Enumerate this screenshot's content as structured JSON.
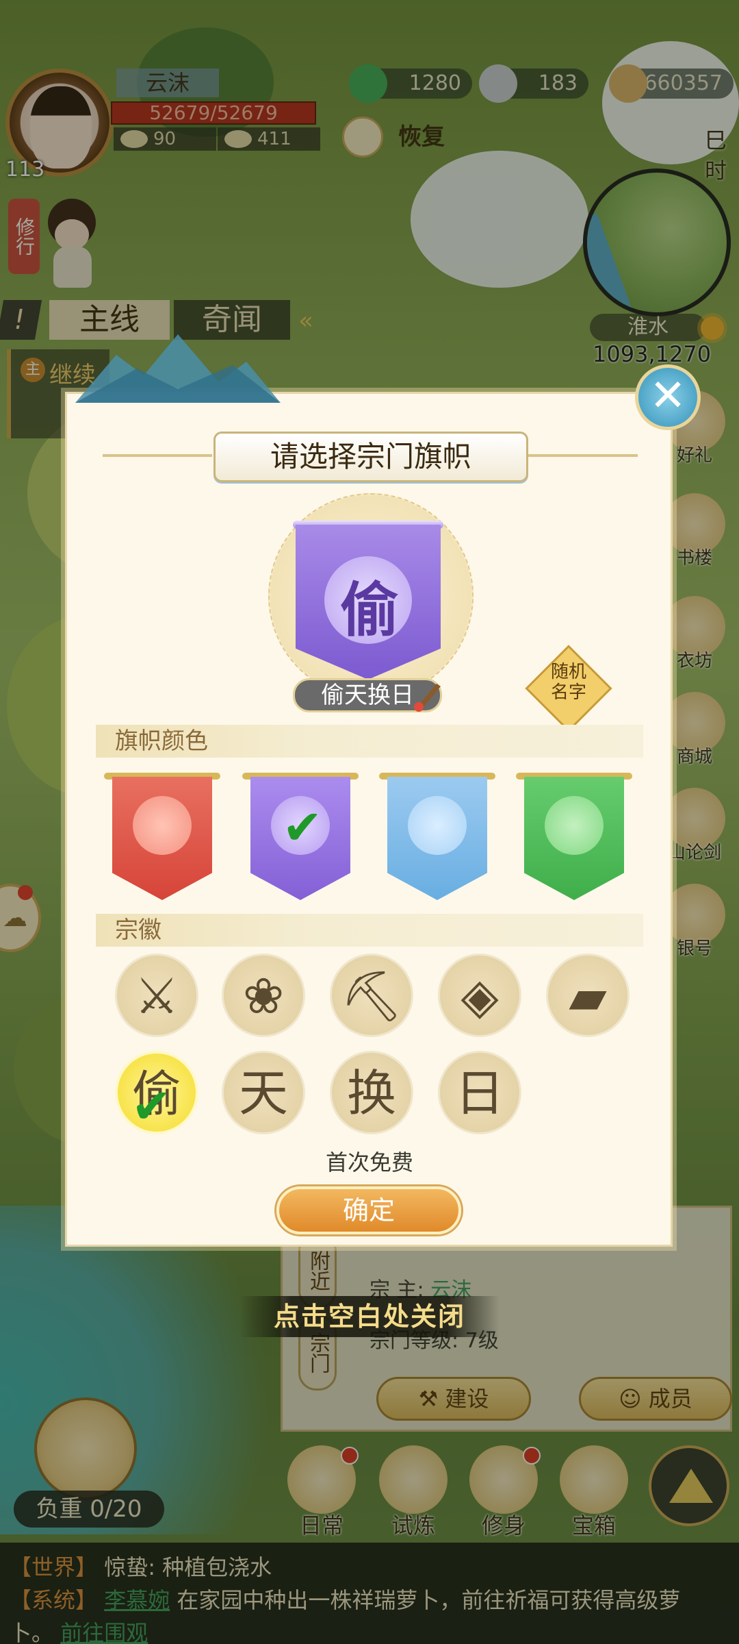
{
  "hud": {
    "player_name": "云沫",
    "level": "113",
    "hp": "52679/52679",
    "stat1": "90",
    "stat2": "411",
    "resources": [
      {
        "icon": "jade-dragon-icon",
        "value": "1280"
      },
      {
        "icon": "silver-ingot-icon",
        "value": "183"
      },
      {
        "icon": "copper-coins-icon",
        "value": "660357"
      }
    ],
    "restore_label": "恢复",
    "corner_top": "巳",
    "corner_bottom": "时",
    "cultivate_label": "修行",
    "location_name": "淮水",
    "location_coords": "1093,1270"
  },
  "quest": {
    "tabs": [
      "主线",
      "奇闻"
    ],
    "exclaim": "!",
    "badge": "主",
    "title": "继续"
  },
  "side_menu": [
    {
      "label": "好礼"
    },
    {
      "label": "书楼"
    },
    {
      "label": "衣坊"
    },
    {
      "label": "商城"
    },
    {
      "label": "山论剑"
    },
    {
      "label": "银号"
    }
  ],
  "sect_panel": {
    "tabs": [
      "附近",
      "宗门"
    ],
    "leader_label": "宗  主:",
    "leader_value": "云沫",
    "level_label": "宗门等级:",
    "level_value": "7级",
    "build_label": "建设",
    "members_label": "成员"
  },
  "close_hint": "点击空白处关闭",
  "bottom": {
    "weight": "负重 0/20",
    "nav": [
      "日常",
      "试炼",
      "修身",
      "宝箱"
    ]
  },
  "chat": {
    "line1_channel": "【世界】",
    "line1_text": "惊蛰: 种植包浇水",
    "line2_channel": "【系统】",
    "line2_player": "李慕婉",
    "line2_text": " 在家园中种出一株祥瑞萝卜，前往祈福可获得高级萝",
    "line3_text": "卜。",
    "line3_link": "前往围观"
  },
  "modal": {
    "title": "请选择宗门旗帜",
    "preview_char": "偷",
    "preview_name": "偷天换日",
    "random_label_1": "随机",
    "random_label_2": "名字",
    "color_section": "旗帜颜色",
    "colors": [
      {
        "name": "red",
        "hex": "#e2574a",
        "selected": false
      },
      {
        "name": "purple",
        "hex": "#9a78e0",
        "selected": true
      },
      {
        "name": "blue",
        "hex": "#7cb8e8",
        "selected": false
      },
      {
        "name": "green",
        "hex": "#4fbe5a",
        "selected": false
      }
    ],
    "emblem_section": "宗徽",
    "emblems_icons": [
      "crossed-swords-icon",
      "lotus-icon",
      "pickaxe-icon",
      "coin-icon",
      "book-icon"
    ],
    "emblems_chars": [
      "偷",
      "天",
      "换",
      "日"
    ],
    "selected_emblem": "偷",
    "free_text": "首次免费",
    "confirm_label": "确定",
    "check_mark": "✔"
  }
}
